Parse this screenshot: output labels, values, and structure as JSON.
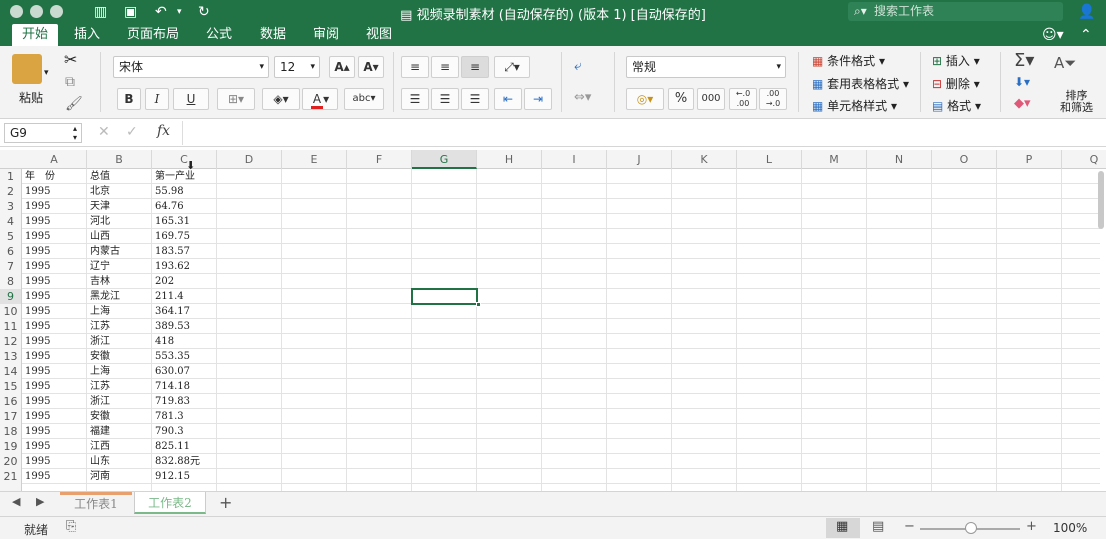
{
  "titlebar": {
    "doc_title": "视频录制素材 (自动保存的) (版本 1) [自动保存的]",
    "search_placeholder": "搜索工作表"
  },
  "ribbon_tabs": [
    "开始",
    "插入",
    "页面布局",
    "公式",
    "数据",
    "审阅",
    "视图"
  ],
  "ribbon": {
    "paste_label": "粘贴",
    "font_name": "宋体",
    "font_size": "12",
    "number_format": "常规",
    "percent": "%",
    "thousands": "000",
    "conditional_format": "条件格式",
    "table_format": "套用表格格式",
    "cell_styles": "单元格样式",
    "insert": "插入",
    "delete": "删除",
    "format": "格式",
    "sort_filter_1": "排序",
    "sort_filter_2": "和筛选",
    "bold": "B",
    "italic": "I",
    "underline": "U",
    "font_color_glyph": "A",
    "abc": "abc",
    "dec_left": "←.0",
    "dec_right": ".00",
    "dec_right2": "→.0",
    "dec_inc": ".00",
    "increase_font": "A",
    "decrease_font": "A"
  },
  "formula_bar": {
    "name_box": "G9",
    "fx": "fx",
    "cancel": "✕",
    "confirm": "✓"
  },
  "grid": {
    "columns": [
      "A",
      "B",
      "C",
      "D",
      "E",
      "F",
      "G",
      "H",
      "I",
      "J",
      "K",
      "L",
      "M",
      "N",
      "O",
      "P",
      "Q"
    ],
    "selected_cell": "G9",
    "rows": [
      {
        "n": "1",
        "a": "年　份",
        "b": "总值",
        "c": "第一产业"
      },
      {
        "n": "2",
        "a": "1995",
        "b": "北京",
        "c": "55.98"
      },
      {
        "n": "3",
        "a": "1995",
        "b": "天津",
        "c": "64.76"
      },
      {
        "n": "4",
        "a": "1995",
        "b": "河北",
        "c": "165.31"
      },
      {
        "n": "5",
        "a": "1995",
        "b": "山西",
        "c": "169.75"
      },
      {
        "n": "6",
        "a": "1995",
        "b": "内蒙古",
        "c": "183.57"
      },
      {
        "n": "7",
        "a": "1995",
        "b": "辽宁",
        "c": "193.62"
      },
      {
        "n": "8",
        "a": "1995",
        "b": "吉林",
        "c": "202"
      },
      {
        "n": "9",
        "a": "1995",
        "b": "黑龙江",
        "c": "211.4"
      },
      {
        "n": "10",
        "a": "1995",
        "b": "上海",
        "c": "364.17"
      },
      {
        "n": "11",
        "a": "1995",
        "b": "江苏",
        "c": "389.53"
      },
      {
        "n": "12",
        "a": "1995",
        "b": "浙江",
        "c": "418"
      },
      {
        "n": "13",
        "a": "1995",
        "b": "安徽",
        "c": "553.35"
      },
      {
        "n": "14",
        "a": "1995",
        "b": "上海",
        "c": "630.07"
      },
      {
        "n": "15",
        "a": "1995",
        "b": "江苏",
        "c": "714.18"
      },
      {
        "n": "16",
        "a": "1995",
        "b": "浙江",
        "c": "719.83"
      },
      {
        "n": "17",
        "a": "1995",
        "b": "安徽",
        "c": "781.3"
      },
      {
        "n": "18",
        "a": "1995",
        "b": "福建",
        "c": "790.3"
      },
      {
        "n": "19",
        "a": "1995",
        "b": "江西",
        "c": "825.11"
      },
      {
        "n": "20",
        "a": "1995",
        "b": "山东",
        "c": "832.88元"
      },
      {
        "n": "21",
        "a": "1995",
        "b": "河南",
        "c": "912.15"
      }
    ]
  },
  "sheet_tabs": [
    "工作表1",
    "工作表2"
  ],
  "add_sheet": "+",
  "status": {
    "ready": "就绪",
    "zoom": "100%",
    "zoom_minus": "−",
    "zoom_plus": "+"
  },
  "colors": {
    "accent": "#217346",
    "font_red": "#e02020"
  }
}
